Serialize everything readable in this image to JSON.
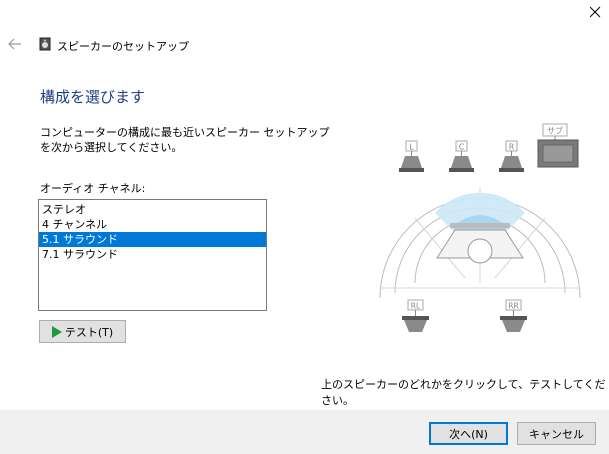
{
  "window": {
    "title": "スピーカーのセットアップ",
    "close_icon": "close-icon",
    "back_icon": "back-arrow-icon",
    "app_icon": "speaker-app-icon"
  },
  "page": {
    "heading": "構成を選びます",
    "instructions": "コンピューターの構成に最も近いスピーカー セットアップを次から選択してください。",
    "channel_label": "オーディオ チャネル:"
  },
  "channels": {
    "options": [
      "ステレオ",
      "4 チャンネル",
      "5.1 サラウンド",
      "7.1 サラウンド"
    ],
    "selected": "5.1 サラウンド"
  },
  "test_button": {
    "label": "テスト(T)"
  },
  "diagram": {
    "labels": {
      "left": "L",
      "center": "C",
      "right": "R",
      "sub": "サブ",
      "rear_left": "RL",
      "rear_right": "RR"
    }
  },
  "hint": "上のスピーカーのどれかをクリックして、テストしてください。",
  "footer": {
    "next_label": "次へ(N)",
    "cancel_label": "キャンセル"
  },
  "colors": {
    "accent": "#0078d7",
    "heading": "#1e3f86",
    "play": "#1d9a3b"
  }
}
